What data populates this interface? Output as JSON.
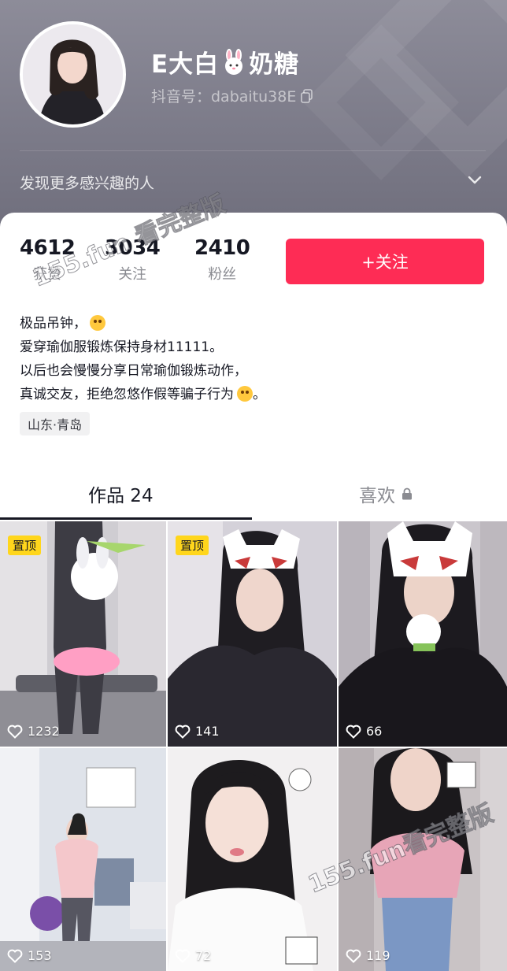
{
  "profile": {
    "name_part1": "E大白",
    "name_part2": "奶糖",
    "douyin_id": "抖音号：dabaitu38E",
    "discover_text": "发现更多感兴趣的人"
  },
  "stats": [
    {
      "value": "4612",
      "label": "获赞"
    },
    {
      "value": "3034",
      "label": "关注"
    },
    {
      "value": "2410",
      "label": "粉丝"
    }
  ],
  "follow_button": "+关注",
  "bio": [
    "极品吊钟，",
    "爱穿瑜伽服锻炼保持身材11111。",
    "以后也会慢慢分享日常瑜伽锻炼动作，",
    "真诚交友，拒绝忽悠作假等骗子行为"
  ],
  "bio_end": "。",
  "location": "山东·青岛",
  "tabs": {
    "works": "作品 24",
    "likes": "喜欢"
  },
  "pinned_label": "置顶",
  "videos": [
    {
      "likes": "1232",
      "pinned": true
    },
    {
      "likes": "141",
      "pinned": true
    },
    {
      "likes": "66",
      "pinned": false
    },
    {
      "likes": "153",
      "pinned": false
    },
    {
      "likes": "72",
      "pinned": false
    },
    {
      "likes": "119",
      "pinned": false
    }
  ],
  "watermark": {
    "top": "155.fun 看完整版",
    "bottom": "155.fun看完整版"
  },
  "colors": {
    "accent": "#fe2c55",
    "pin_badge": "#ffd61c",
    "header_bg": "#7c7b89"
  }
}
